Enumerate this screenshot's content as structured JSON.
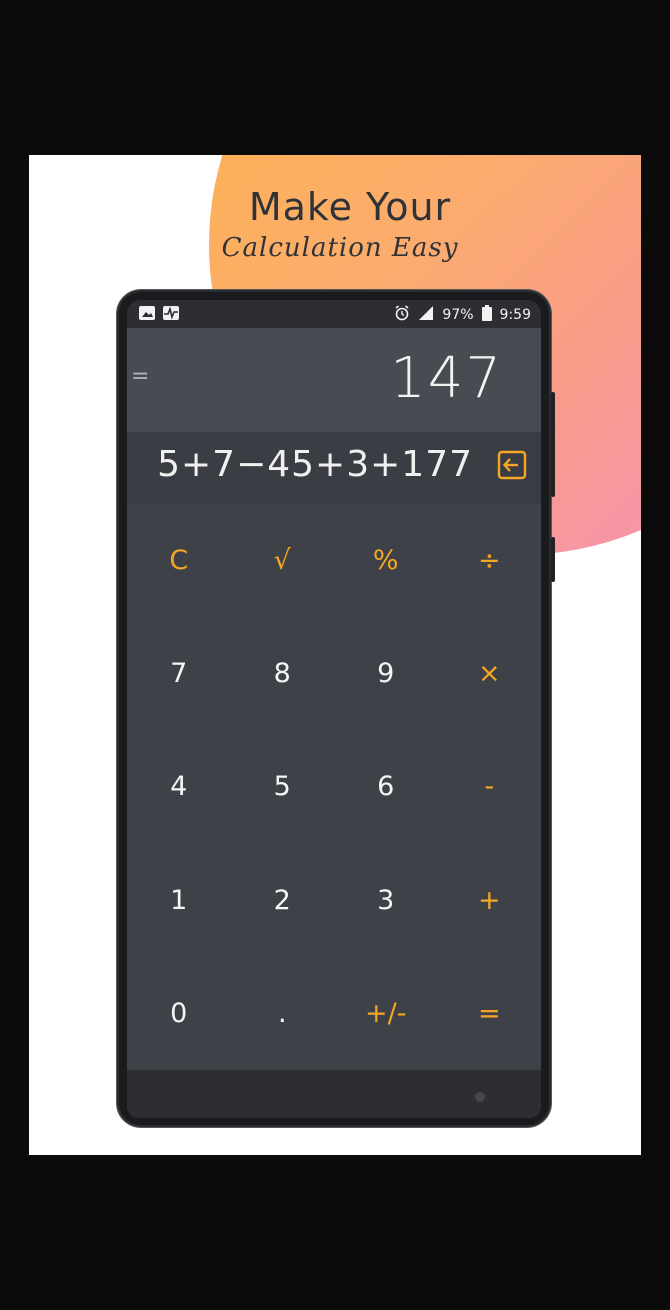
{
  "promo": {
    "headline_line1": "Make Your",
    "headline_line2": "Calculation Easy"
  },
  "colors": {
    "accent": "#f5a623",
    "screen_bg": "#3e4148",
    "result_bg": "#474b52",
    "text": "#f5f5f5",
    "gradient_start": "#fbb44a",
    "gradient_end": "#f48fc3"
  },
  "status_bar": {
    "left_icons": [
      "image-icon",
      "activity-icon"
    ],
    "alarm_icon": "alarm-icon",
    "signal_icon": "signal-icon",
    "battery": "97%",
    "battery_icon": "battery-icon",
    "time": "9:59"
  },
  "display": {
    "equals_symbol": "=",
    "result": "147",
    "expression": "5+7−45+3+177",
    "backspace_icon": "backspace-icon"
  },
  "keypad": {
    "row1": [
      "C",
      "√",
      "%",
      "÷"
    ],
    "row2": [
      "7",
      "8",
      "9",
      "×"
    ],
    "row3": [
      "4",
      "5",
      "6",
      "-"
    ],
    "row4": [
      "1",
      "2",
      "3",
      "+"
    ],
    "row5": [
      "0",
      ".",
      "+/-",
      "="
    ]
  }
}
